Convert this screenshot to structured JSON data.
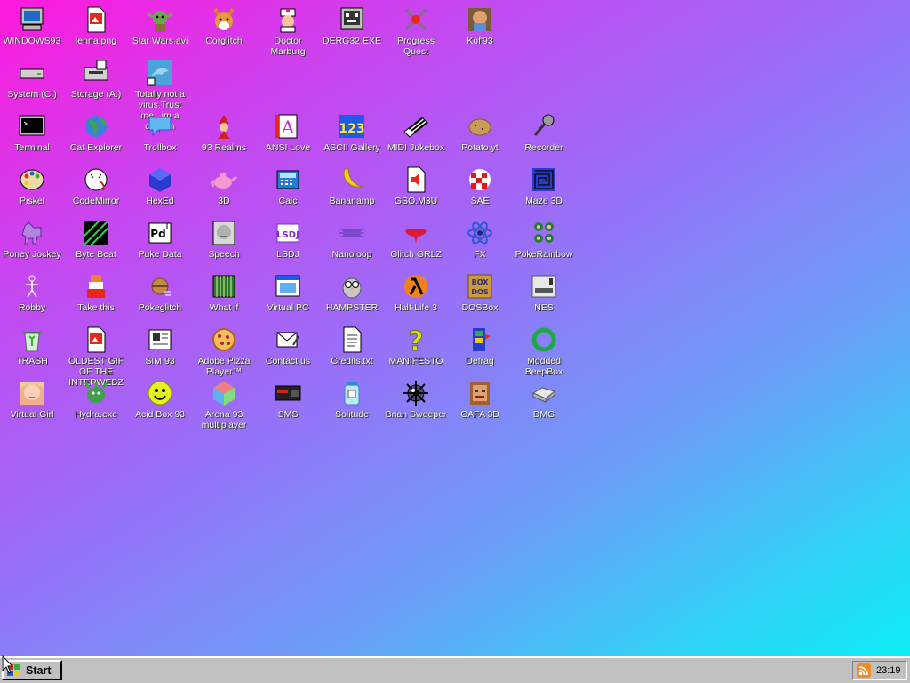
{
  "colors": {
    "accent": "#ff19dc",
    "accent2": "#07f2f4",
    "taskbar": "#c0c0c0"
  },
  "desktop": {
    "icons": [
      {
        "label": "WINDOWS93",
        "icon": "computer-icon"
      },
      {
        "label": "lenna.png",
        "icon": "image-file-icon"
      },
      {
        "label": "Star Wars.avi",
        "icon": "yoda-icon"
      },
      {
        "label": "Corglitch",
        "icon": "corgi-icon"
      },
      {
        "label": "Doctor Marburg",
        "icon": "doctor-icon"
      },
      {
        "label": "DERG32.EXE",
        "icon": "derg-face-icon"
      },
      {
        "label": "Progress Quest",
        "icon": "crossed-swords-icon"
      },
      {
        "label": "Kof'93",
        "icon": "fighter-portrait-icon"
      },
      {
        "label": "System (C:)",
        "icon": "hard-drive-icon"
      },
      {
        "label": "Storage (A:)",
        "icon": "floppy-drive-icon"
      },
      {
        "label": "Totally not a virus.Trust me...im a dolphin",
        "icon": "dolphin-icon"
      },
      {
        "label": "Terminal",
        "icon": "terminal-icon"
      },
      {
        "label": "Cat Explorer",
        "icon": "globe-icon"
      },
      {
        "label": "Trollbox",
        "icon": "chat-bubble-icon"
      },
      {
        "label": "93 Realms",
        "icon": "red-wizard-icon"
      },
      {
        "label": "ANSI Love",
        "icon": "ansi-letter-icon"
      },
      {
        "label": "ASCII Gallery",
        "icon": "ascii-123-icon"
      },
      {
        "label": "MIDI Jukebox",
        "icon": "piano-keys-icon"
      },
      {
        "label": "Potato.yt",
        "icon": "potato-icon"
      },
      {
        "label": "Recorder",
        "icon": "microphone-icon"
      },
      {
        "label": "Piskel",
        "icon": "palette-icon"
      },
      {
        "label": "CodeMirror",
        "icon": "cat-mirror-icon"
      },
      {
        "label": "HexEd",
        "icon": "cube-icon"
      },
      {
        "label": "3D",
        "icon": "teapot-icon"
      },
      {
        "label": "Calc",
        "icon": "calculator-icon"
      },
      {
        "label": "Bananamp",
        "icon": "banana-icon"
      },
      {
        "label": "GSO.M3U",
        "icon": "speaker-file-icon"
      },
      {
        "label": "SAE",
        "icon": "amiga-ball-icon"
      },
      {
        "label": "Maze 3D",
        "icon": "maze-icon"
      },
      {
        "label": "Poney Jockey",
        "icon": "pony-icon"
      },
      {
        "label": "Byte Beat",
        "icon": "bytebeat-icon"
      },
      {
        "label": "Puke Data",
        "icon": "pd-icon"
      },
      {
        "label": "Speech",
        "icon": "face-speech-icon"
      },
      {
        "label": "LSDJ",
        "icon": "lsdj-icon"
      },
      {
        "label": "Nanoloop",
        "icon": "waveform-icon"
      },
      {
        "label": "Glitch GRLZ",
        "icon": "lips-icon"
      },
      {
        "label": "FX",
        "icon": "atom-icon"
      },
      {
        "label": "PokeRainbow",
        "icon": "trainers-icon"
      },
      {
        "label": "Robby",
        "icon": "stick-robot-icon"
      },
      {
        "label": "Take this",
        "icon": "pixel-guy-icon"
      },
      {
        "label": "Pokeglitch",
        "icon": "pokeball-glitch-icon"
      },
      {
        "label": "What if",
        "icon": "grid-screen-icon"
      },
      {
        "label": "Virtual PC",
        "icon": "window-app-icon"
      },
      {
        "label": "HAMPSTER",
        "icon": "owl-icon"
      },
      {
        "label": "Half-Life 3",
        "icon": "lambda-icon"
      },
      {
        "label": "DOSBox",
        "icon": "dosbox-icon"
      },
      {
        "label": "NES",
        "icon": "nes-console-icon"
      },
      {
        "label": "TRASH",
        "icon": "trash-icon"
      },
      {
        "label": "OLDEST GIF OF THE INTERWEBZ",
        "icon": "gif-file-icon"
      },
      {
        "label": "SIM 93",
        "icon": "sim-card-icon"
      },
      {
        "label": "Adobe Pizza Player™",
        "icon": "pizza-icon"
      },
      {
        "label": "Contact us",
        "icon": "mail-icon"
      },
      {
        "label": "Credits.txt",
        "icon": "text-file-icon"
      },
      {
        "label": "MANIFESTO",
        "icon": "question-icon"
      },
      {
        "label": "Defrag",
        "icon": "defrag-icon"
      },
      {
        "label": "Modded BeepBox",
        "icon": "ring-icon"
      },
      {
        "label": "Virtual Girl",
        "icon": "girl-face-icon"
      },
      {
        "label": "Hydra.exe",
        "icon": "hydra-icon"
      },
      {
        "label": "Acid Box 93",
        "icon": "smiley-icon"
      },
      {
        "label": "Arena 93 multiplayer",
        "icon": "color-cube-icon"
      },
      {
        "label": "SMS",
        "icon": "sms-console-icon"
      },
      {
        "label": "Solitude",
        "icon": "jar-icon"
      },
      {
        "label": "Brian Sweeper",
        "icon": "mine-icon"
      },
      {
        "label": "GAFA 3D",
        "icon": "doomguy-icon"
      },
      {
        "label": "DMG",
        "icon": "dmg-drive-icon"
      }
    ]
  },
  "taskbar": {
    "start_label": "Start",
    "clock": "23:19",
    "tray_icon": "rss-icon"
  }
}
